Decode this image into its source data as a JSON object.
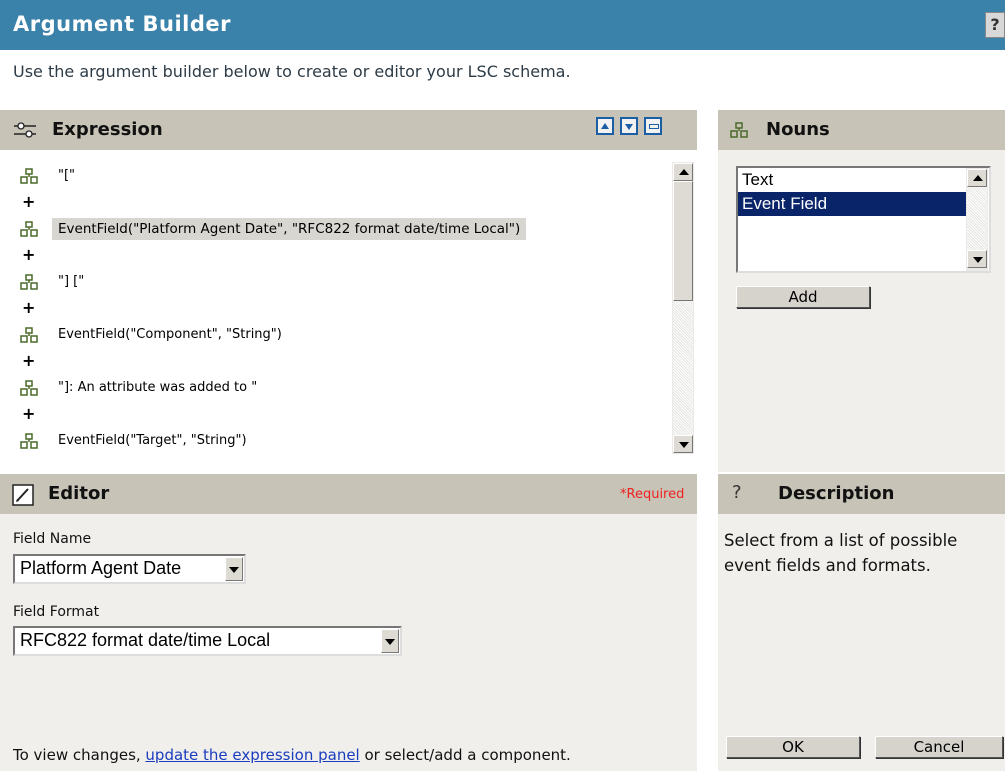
{
  "header": {
    "title": "Argument Builder",
    "help_glyph": "?",
    "subtitle": "Use the argument builder below to create or editor your LSC schema."
  },
  "expression_panel": {
    "title": "Expression",
    "icon": "expression-icon",
    "items": [
      {
        "text": "\"[\"",
        "selected": false
      },
      {
        "text": "EventField(\"Platform Agent Date\", \"RFC822 format date/time Local\")",
        "selected": true
      },
      {
        "text": "\"] [\"",
        "selected": false
      },
      {
        "text": "EventField(\"Component\", \"String\")",
        "selected": false
      },
      {
        "text": "\"]: An attribute was added to \"",
        "selected": false
      },
      {
        "text": "EventField(\"Target\", \"String\")",
        "selected": false
      }
    ],
    "operator": "+"
  },
  "nouns_panel": {
    "title": "Nouns",
    "items": [
      "Text",
      "Event Field"
    ],
    "selected": "Event Field",
    "add_label": "Add"
  },
  "editor_panel": {
    "title": "Editor",
    "required_label": "*Required",
    "field_name_label": "Field Name",
    "field_name_value": "Platform Agent Date",
    "field_format_label": "Field Format",
    "field_format_value": "RFC822 format date/time Local",
    "footer_prefix": "To view changes, ",
    "footer_link": "update the expression panel",
    "footer_suffix": " or select/add a component."
  },
  "description_panel": {
    "title": "Description",
    "text_line1": "Select from a list of possible",
    "text_line2": "event fields and formats.",
    "ok_label": "OK",
    "cancel_label": "Cancel"
  },
  "colors": {
    "title_bar": "#3b82ab",
    "panel_header": "#c7c3b6",
    "panel_body": "#f0efeb",
    "selection": "#0a246a",
    "required": "#e22222",
    "link": "#1a3cbf"
  }
}
